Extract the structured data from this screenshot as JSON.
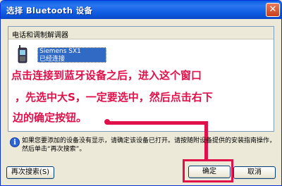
{
  "window": {
    "title": "选择 Bluetooth 设备",
    "close_symbol": "✕"
  },
  "group": {
    "title": "电话和调制解调器"
  },
  "device": {
    "name": "Siemens SX1",
    "status": "已经连接",
    "icon": "mobile-phone-icon"
  },
  "annotations": {
    "line1": "点击连接到蓝牙设备之后，进入这个窗口",
    "line2": "，先选中大S，一定要选中，然后点击右下",
    "line3": "边的确定按钮。"
  },
  "info": {
    "icon": "info-icon",
    "symbol": "i",
    "text": "如果您要添加的设备没有显示，请确定该设备已打开。请按随附设备提供的安装指南操作，然后单击“再次搜索”。"
  },
  "buttons": {
    "search_again": "再次搜索(S)",
    "ok": "确定",
    "cancel": "取消"
  },
  "colors": {
    "annotation": "#e0104a",
    "selection": "#316ac5",
    "titlebar": "#0a5ee4"
  }
}
